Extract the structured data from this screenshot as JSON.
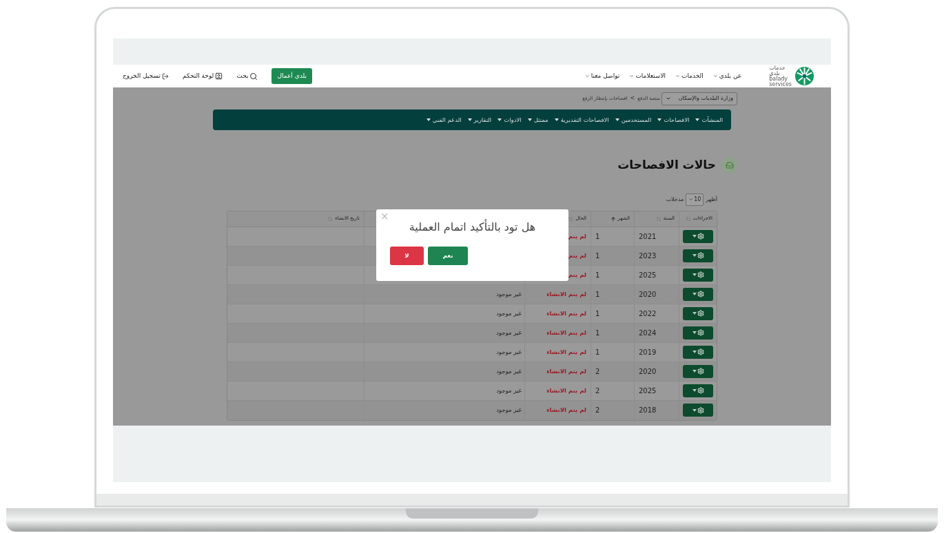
{
  "header": {
    "logo": {
      "lines": [
        "خدمات",
        "بلدي",
        "balady",
        "services"
      ]
    },
    "nav": [
      {
        "label": "عن بلدي"
      },
      {
        "label": "الخدمات"
      },
      {
        "label": "الاستعلامات"
      },
      {
        "label": "تواصل معنا"
      }
    ],
    "business_button": "بلدي أعمال",
    "search": "بحث",
    "dashboard": "لوحة التحكم",
    "logout": "تسجيل الخروج"
  },
  "breadcrumb": {
    "select": "وزارة البلديات والإسكان",
    "items": [
      "منصة الدفع",
      "افصاحات بإنتظار الرفع"
    ],
    "separator": ">"
  },
  "menu": [
    {
      "label": "المنشآت"
    },
    {
      "label": "الافصاحات"
    },
    {
      "label": "المستخدمين"
    },
    {
      "label": "الافصاحات التقديرية"
    },
    {
      "label": "ممتثل"
    },
    {
      "label": "الادوات"
    },
    {
      "label": "التقارير"
    },
    {
      "label": "الدعم الفني"
    }
  ],
  "page_title": "حالات الافصاحات",
  "length": {
    "show": "أظهر",
    "value": "10",
    "entries": "مدخلات"
  },
  "table": {
    "columns": [
      {
        "label": "الاجراءات",
        "sorted": false
      },
      {
        "label": "السنة",
        "sorted": false
      },
      {
        "label": "الشهر",
        "sorted": true
      },
      {
        "label": "الحال",
        "sorted": false
      },
      {},
      {
        "label": "تاريخ الانشاء",
        "sorted": false
      }
    ],
    "rows": [
      {
        "year": "2021",
        "month": "1",
        "status": "لم يتم"
      },
      {
        "year": "2023",
        "month": "1",
        "status": "لم يتم"
      },
      {
        "year": "2025",
        "month": "1",
        "status": "لم يتم"
      },
      {
        "year": "2020",
        "month": "1",
        "status": "لم يتم الانشاء",
        "existence": "غير موجود"
      },
      {
        "year": "2022",
        "month": "1",
        "status": "لم يتم الانشاء",
        "existence": "غير موجود"
      },
      {
        "year": "2024",
        "month": "1",
        "status": "لم يتم الانشاء",
        "existence": "غير موجود"
      },
      {
        "year": "2019",
        "month": "1",
        "status": "لم يتم الانشاء",
        "existence": "غير موجود"
      },
      {
        "year": "2020",
        "month": "2",
        "status": "لم يتم الانشاء",
        "existence": "غير موجود"
      },
      {
        "year": "2025",
        "month": "2",
        "status": "لم يتم الانشاء",
        "existence": "غير موجود"
      },
      {
        "year": "2018",
        "month": "2",
        "status": "لم يتم الانشاء",
        "existence": "غير موجود"
      }
    ]
  },
  "dialog": {
    "close": "×",
    "title": "هل تود بالتأكيد اتمام العملية",
    "buttons": [
      {
        "label": "نعم",
        "kind": "confirm"
      },
      {
        "label": "لا",
        "kind": "cancel"
      }
    ]
  }
}
